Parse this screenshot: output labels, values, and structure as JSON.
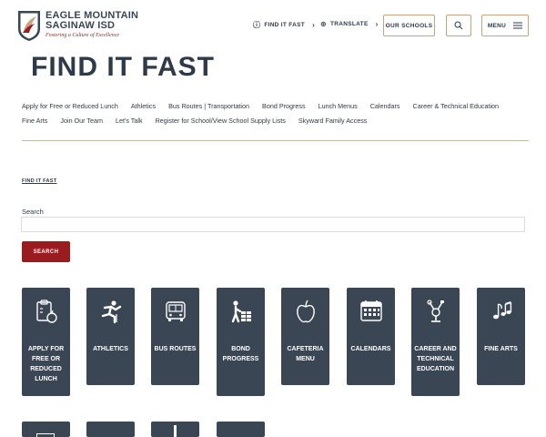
{
  "brand": {
    "line1": "EAGLE MOUNTAIN",
    "line2": "SAGINAW ISD",
    "tagline": "Fostering a Culture of Excellence"
  },
  "header": {
    "find_it_fast": "FIND IT FAST",
    "translate": "TRANSLATE",
    "our_schools": "OUR SCHOOLS",
    "menu": "MENU"
  },
  "page_title": "FIND IT FAST",
  "quick_links_row1": [
    "Apply for Free or Reduced Lunch",
    "Athletics",
    "Bus Routes | Transportation",
    "Bond Progress",
    "Lunch Menus",
    "Calendars",
    "Career & Technical Education"
  ],
  "quick_links_row2": [
    "Fine Arts",
    "Join Our Team",
    "Let's Talk",
    "Register for School/View School Supply Lists",
    "Skyward Family Access"
  ],
  "breadcrumb": "FIND IT FAST",
  "search": {
    "label": "Search",
    "value": "",
    "button": "SEARCH"
  },
  "tiles": [
    {
      "label": "APPLY FOR FREE OR REDUCED LUNCH",
      "icon": "clipboard-apple-icon"
    },
    {
      "label": "ATHLETICS",
      "icon": "hurdler-icon"
    },
    {
      "label": "BUS ROUTES",
      "icon": "bus-icon"
    },
    {
      "label": "BOND PROGRESS",
      "icon": "builder-bricks-icon"
    },
    {
      "label": "CAFETERIA MENU",
      "icon": "apple-icon"
    },
    {
      "label": "CALENDARS",
      "icon": "calendar-icon"
    },
    {
      "label": "CAREER AND TECHNICAL EDUCATION",
      "icon": "tools-icon"
    },
    {
      "label": "FINE ARTS",
      "icon": "music-notes-icon"
    }
  ],
  "colors": {
    "tile": "#3b4655",
    "accent": "#9b1c1f",
    "border": "#c9a27e"
  }
}
